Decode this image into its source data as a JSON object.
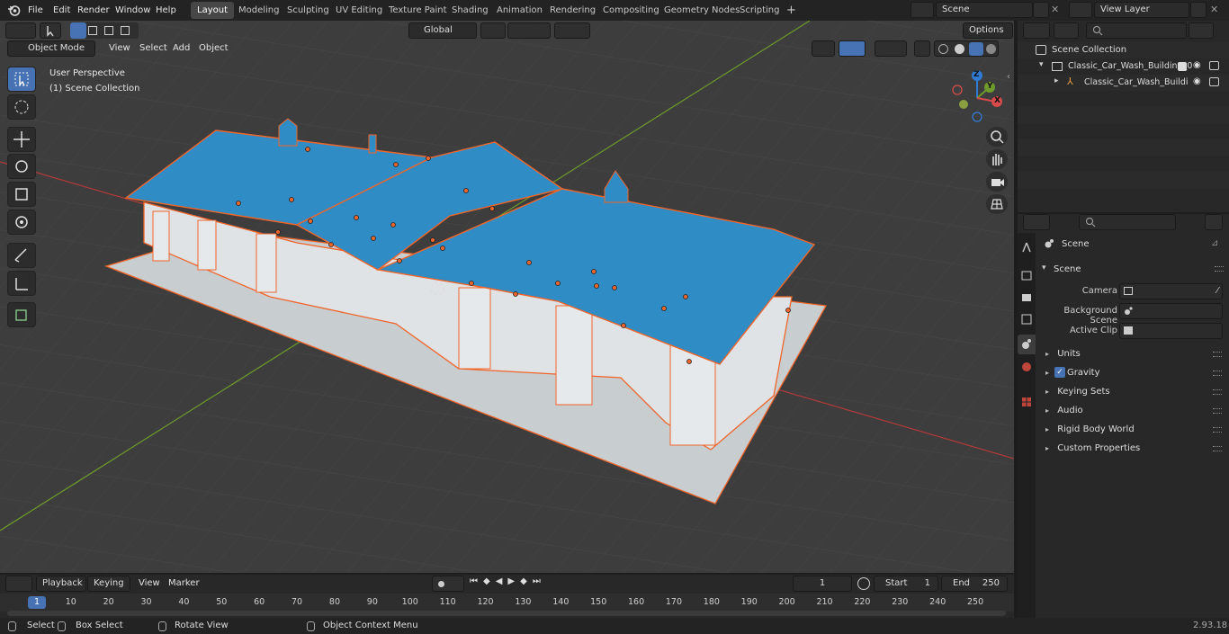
{
  "topbar": {
    "menus": [
      "File",
      "Edit",
      "Render",
      "Window",
      "Help"
    ],
    "workspaces": [
      "Layout",
      "Modeling",
      "Sculpting",
      "UV Editing",
      "Texture Paint",
      "Shading",
      "Animation",
      "Rendering",
      "Compositing",
      "Geometry Nodes",
      "Scripting"
    ],
    "active_workspace": "Layout",
    "add_workspace": "+",
    "scene": "Scene",
    "view_layer": "View Layer"
  },
  "viewport_header": {
    "mode": "Object Mode",
    "menus": [
      "View",
      "Select",
      "Add",
      "Object"
    ],
    "orientation": "Global",
    "options": "Options"
  },
  "viewport": {
    "perspective": "User Perspective",
    "collection": "(1) Scene Collection",
    "gizmo_axes": [
      "Z",
      "Y",
      "X"
    ]
  },
  "outliner": {
    "root": "Scene Collection",
    "items": [
      {
        "label": "Classic_Car_Wash_Building_0"
      },
      {
        "label": "Classic_Car_Wash_Buildi"
      }
    ]
  },
  "properties": {
    "context": "Scene",
    "section": "Scene",
    "fields": [
      {
        "label": "Camera"
      },
      {
        "label": "Background Scene"
      },
      {
        "label": "Active Clip"
      }
    ],
    "panels": [
      "Units",
      "Gravity",
      "Keying Sets",
      "Audio",
      "Rigid Body World",
      "Custom Properties"
    ],
    "gravity_checked": true
  },
  "timeline": {
    "menus": [
      "Playback",
      "Keying",
      "View",
      "Marker"
    ],
    "current_frame": "1",
    "start_label": "Start",
    "start": "1",
    "end_label": "End",
    "end": "250",
    "ticks": [
      "1",
      "10",
      "20",
      "30",
      "40",
      "50",
      "60",
      "70",
      "80",
      "90",
      "100",
      "110",
      "120",
      "130",
      "140",
      "150",
      "160",
      "170",
      "180",
      "190",
      "200",
      "210",
      "220",
      "230",
      "240",
      "250"
    ]
  },
  "statusbar": {
    "select": "Select",
    "box_select": "Box Select",
    "rotate": "Rotate View",
    "context_menu": "Object Context Menu",
    "version": "2.93.18"
  },
  "colors": {
    "accent": "#4772b3",
    "selection_outline": "#f0652a",
    "roof": "#2f8cc4",
    "x_axis": "#b33a3a",
    "y_axis": "#6e9b2a"
  }
}
